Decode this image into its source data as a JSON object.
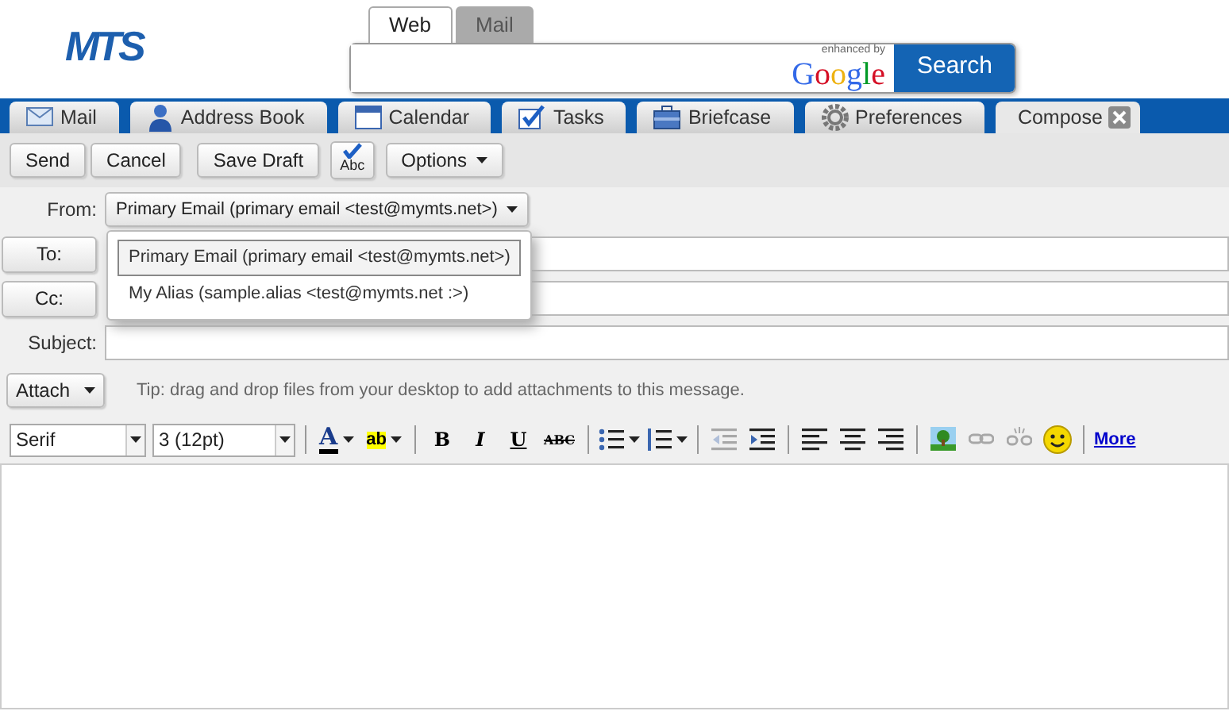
{
  "logo": "MTS",
  "search": {
    "tabs": [
      {
        "label": "Web",
        "selected": true
      },
      {
        "label": "Mail",
        "selected": false
      }
    ],
    "branding": {
      "note": "enhanced by",
      "name": "Google"
    },
    "button": "Search"
  },
  "app_tabs": [
    {
      "label": "Mail",
      "selected": false,
      "closable": false
    },
    {
      "label": "Address Book",
      "selected": false,
      "closable": false
    },
    {
      "label": "Calendar",
      "selected": false,
      "closable": false
    },
    {
      "label": "Tasks",
      "selected": false,
      "closable": false
    },
    {
      "label": "Briefcase",
      "selected": false,
      "closable": false
    },
    {
      "label": "Preferences",
      "selected": false,
      "closable": false
    },
    {
      "label": "Compose",
      "selected": true,
      "closable": true
    }
  ],
  "toolbar": {
    "groups": [
      [
        "Send",
        "Cancel"
      ],
      [
        "Save Draft"
      ]
    ],
    "spell": "Abc",
    "options": "Options"
  },
  "from": {
    "label": "From:",
    "value": "Primary Email (primary email <test@mymts.net>)",
    "expanded": true,
    "options": [
      {
        "label": "Primary Email (primary email <test@mymts.net>)",
        "selected": true
      },
      {
        "label": "My Alias (sample.alias <test@mymts.net :>)",
        "selected": false
      }
    ]
  },
  "to": {
    "label": "To:"
  },
  "cc": {
    "label": "Cc:"
  },
  "subject": {
    "label": "Subject:"
  },
  "attach": {
    "label": "Attach",
    "tip": "Tip: drag and drop files from your desktop to add attachments to this message."
  },
  "format": {
    "font": "Serif",
    "size": "3 (12pt)",
    "groups": [
      [
        {
          "kind": "fontcolor",
          "text": "A",
          "disabled": false
        },
        {
          "kind": "highlight",
          "text": "ab",
          "disabled": false
        }
      ],
      [
        {
          "kind": "bold",
          "text": "B",
          "disabled": false
        },
        {
          "kind": "italic",
          "text": "I",
          "disabled": false
        },
        {
          "kind": "underline",
          "text": "U",
          "disabled": false
        },
        {
          "kind": "strike",
          "text": "ABC",
          "disabled": false
        }
      ],
      [
        {
          "kind": "bullets",
          "disabled": false
        },
        {
          "kind": "numbers",
          "disabled": false
        }
      ],
      [
        {
          "kind": "outdent",
          "disabled": true
        },
        {
          "kind": "indent",
          "disabled": false
        }
      ],
      [
        {
          "kind": "align-left",
          "disabled": false
        },
        {
          "kind": "align-center",
          "disabled": false
        },
        {
          "kind": "align-right",
          "disabled": false
        }
      ],
      [
        {
          "kind": "image",
          "disabled": false
        },
        {
          "kind": "link",
          "disabled": true
        },
        {
          "kind": "unlink",
          "disabled": true
        },
        {
          "kind": "smiley",
          "disabled": false
        }
      ]
    ],
    "more": "More"
  }
}
